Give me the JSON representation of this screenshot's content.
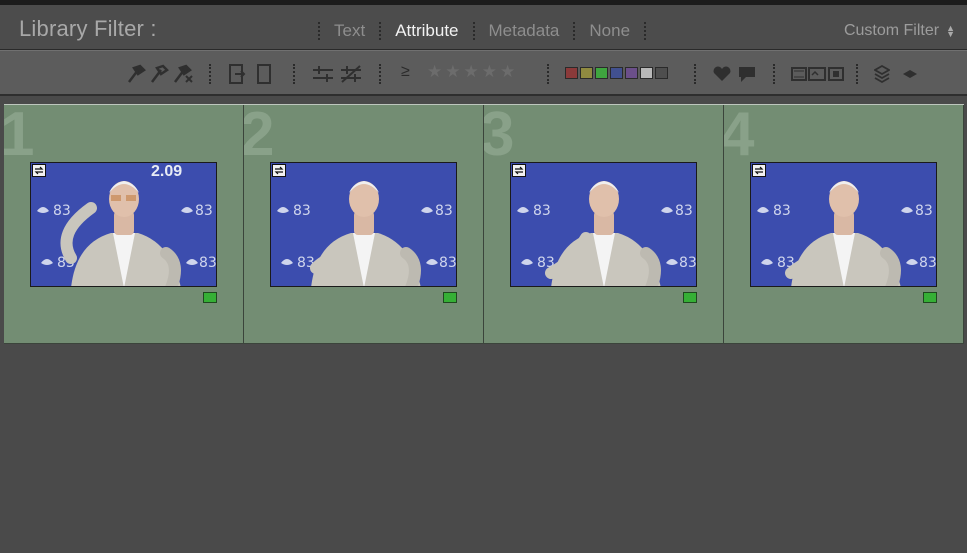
{
  "header": {
    "title": "Library Filter :",
    "tabs": [
      {
        "label": "Text",
        "active": false
      },
      {
        "label": "Attribute",
        "active": true
      },
      {
        "label": "Metadata",
        "active": false
      },
      {
        "label": "None",
        "active": false
      }
    ],
    "preset": "Custom Filter"
  },
  "attribute_bar": {
    "rating_operator": "≥",
    "stars": "★★★★★",
    "rating_value": 0,
    "color_labels": [
      {
        "name": "red",
        "color": "#8b3a3a"
      },
      {
        "name": "yellow",
        "color": "#8f8a40"
      },
      {
        "name": "green",
        "color": "#3fa53f"
      },
      {
        "name": "blue",
        "color": "#41508f"
      },
      {
        "name": "purple",
        "color": "#6b4f8a"
      },
      {
        "name": "no-label",
        "color": "#b8b8b8"
      },
      {
        "name": "other",
        "color": "#4e4e4e"
      }
    ],
    "icons": [
      "flag-picked-icon",
      "flag-unflagged-icon",
      "flag-rejected-icon",
      "edited-icon",
      "unedited-icon",
      "compare-icon",
      "compare-off-icon",
      "heart-icon",
      "comment-icon",
      "video-icon",
      "virtual-copy-icon",
      "master-photo-icon",
      "stack-icon",
      "stack-collapse-icon"
    ]
  },
  "grid": {
    "cells": [
      {
        "index": "1",
        "label_color": "green",
        "backdrop_text": "2.09"
      },
      {
        "index": "2",
        "label_color": "green",
        "backdrop_text": ""
      },
      {
        "index": "3",
        "label_color": "green",
        "backdrop_text": ""
      },
      {
        "index": "4",
        "label_color": "green",
        "backdrop_text": ""
      }
    ]
  },
  "colors": {
    "selected_cell": "#738d73",
    "label_green": "#35b035",
    "backdrop_blue": "#3c4dae"
  }
}
